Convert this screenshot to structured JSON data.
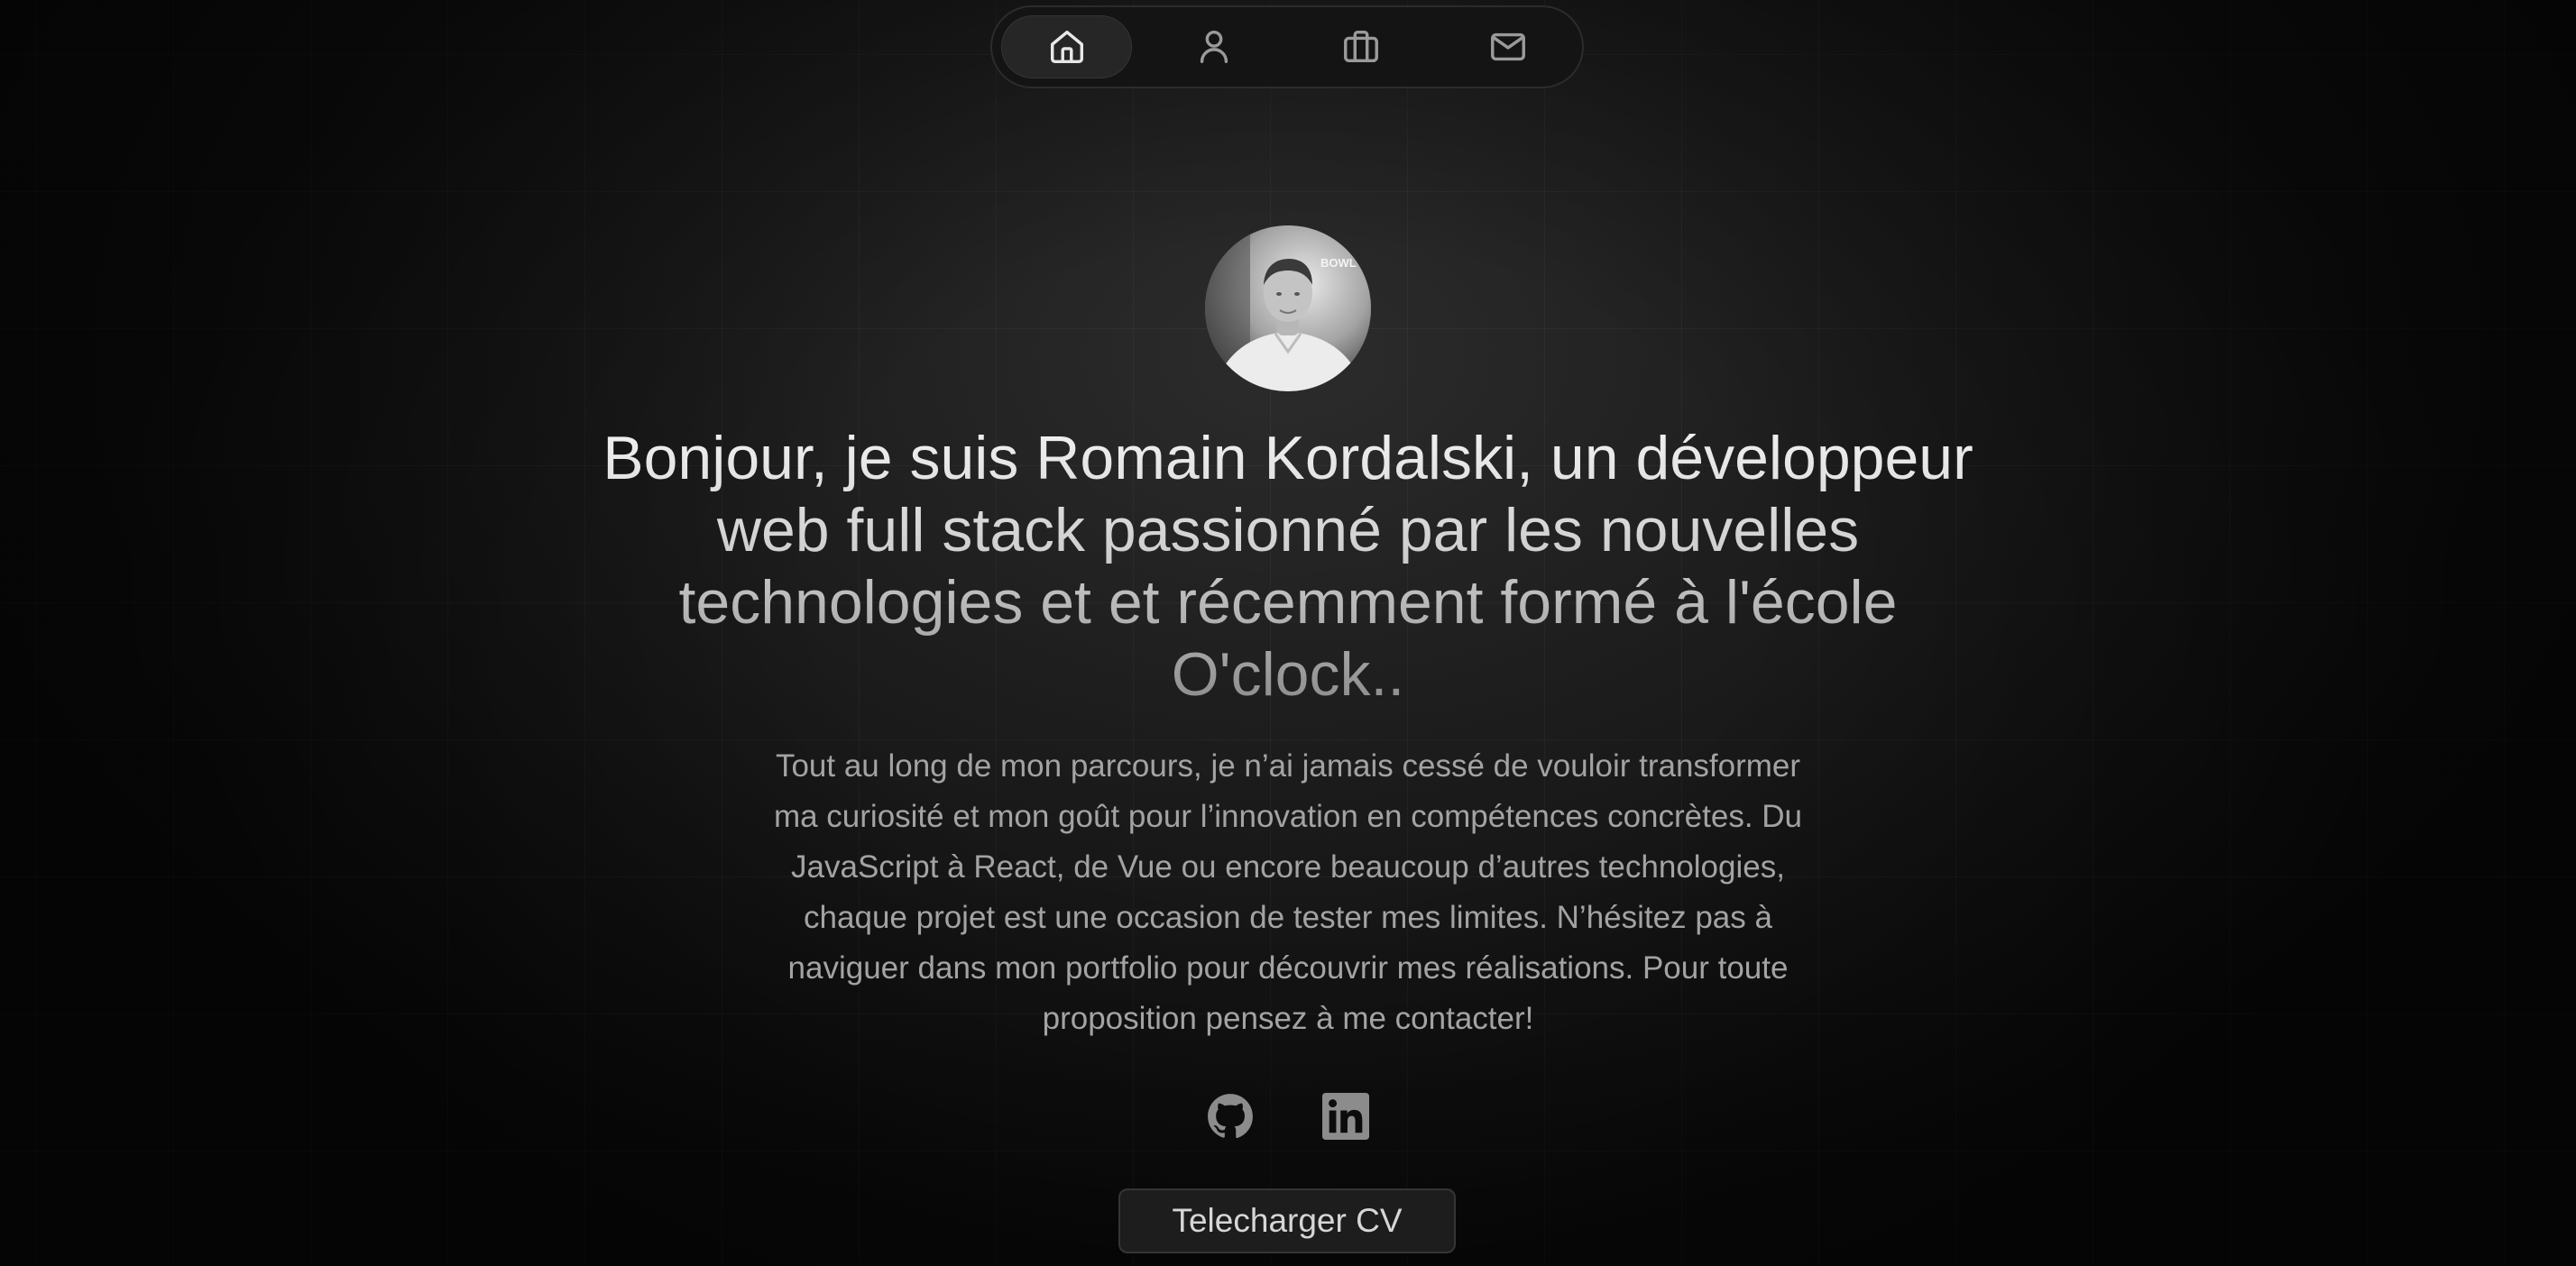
{
  "nav": {
    "items": [
      {
        "icon": "home-icon",
        "active": true
      },
      {
        "icon": "user-icon",
        "active": false
      },
      {
        "icon": "briefcase-icon",
        "active": false
      },
      {
        "icon": "mail-icon",
        "active": false
      }
    ]
  },
  "hero": {
    "headline": "Bonjour, je suis Romain Kordalski, un développeur web full stack passionné par les nouvelles technologies et et récemment formé à l'école O'clock..",
    "bio": "Tout au long de mon parcours, je n’ai jamais cessé de vouloir transformer ma curiosité et mon goût pour l’innovation en compétences concrètes. Du JavaScript à React, de Vue ou encore beaucoup d’autres technologies, chaque projet est une occasion de tester mes limites. N’hésitez pas à naviguer dans mon portfolio pour découvrir mes réalisations. Pour toute proposition pensez à me contacter!",
    "avatar_badge_text": "BOWL"
  },
  "social": {
    "items": [
      {
        "icon": "github-icon"
      },
      {
        "icon": "linkedin-icon"
      }
    ]
  },
  "cv_button": {
    "label": "Telecharger CV"
  },
  "colors": {
    "background": "#0b0b0b",
    "text_primary": "#f2f2f2",
    "text_secondary": "#a3a3a3",
    "icon_muted": "#9a9a9a"
  }
}
